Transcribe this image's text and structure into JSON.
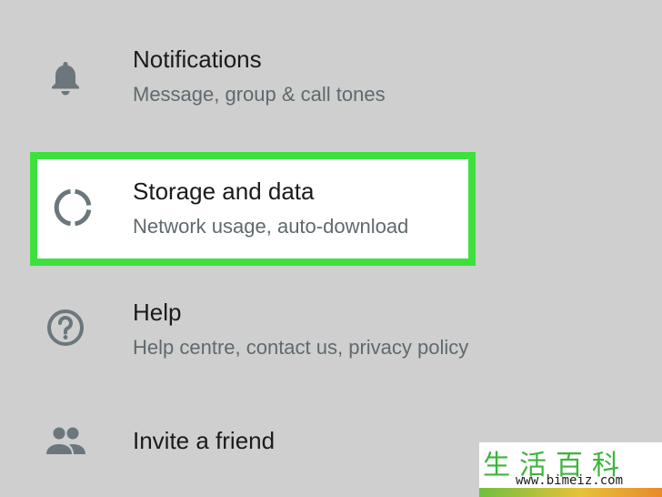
{
  "settings": {
    "items": [
      {
        "id": "notifications",
        "icon": "bell-icon",
        "title": "Notifications",
        "subtitle": "Message, group & call tones"
      },
      {
        "id": "storage",
        "icon": "data-usage-icon",
        "title": "Storage and data",
        "subtitle": "Network usage, auto-download"
      },
      {
        "id": "help",
        "icon": "help-circle-icon",
        "title": "Help",
        "subtitle": "Help centre, contact us, privacy policy"
      },
      {
        "id": "invite",
        "icon": "people-icon",
        "title": "Invite a friend",
        "subtitle": ""
      }
    ]
  },
  "highlight": {
    "target": "storage",
    "color": "#3ee03e"
  },
  "colors": {
    "background": "#cfcfcf",
    "icon": "#6b777c",
    "highlight_bg": "#ffffff"
  },
  "watermark": {
    "chars": "生活百科",
    "url": "www.bimeiz.com"
  }
}
